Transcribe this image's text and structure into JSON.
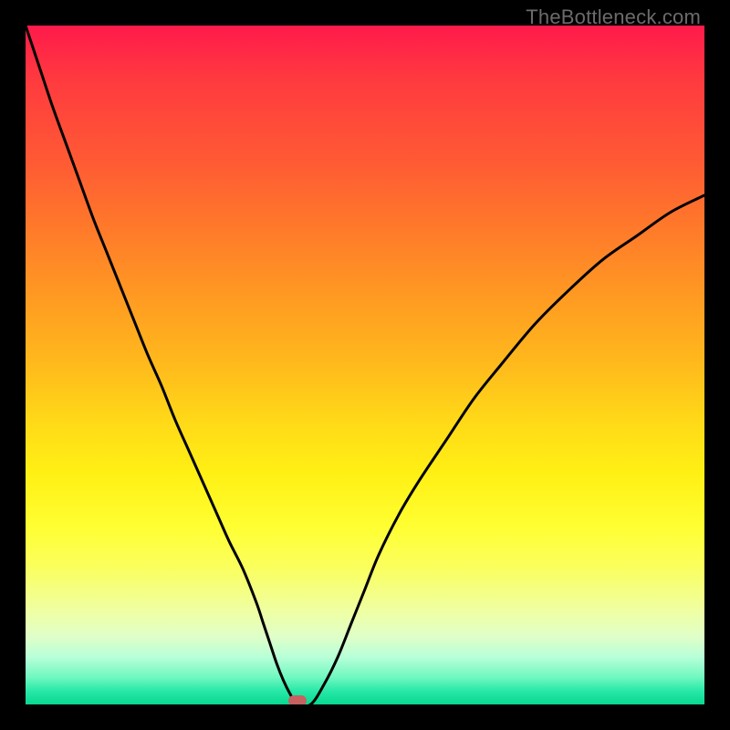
{
  "watermark": "TheBottleneck.com",
  "colors": {
    "frame": "#000000",
    "curve": "#000000",
    "marker": "#c76060"
  },
  "chart_data": {
    "type": "line",
    "title": "",
    "xlabel": "",
    "ylabel": "",
    "xlim": [
      0,
      100
    ],
    "ylim": [
      0,
      100
    ],
    "grid": false,
    "legend": false,
    "series": [
      {
        "name": "bottleneck-curve",
        "x": [
          0,
          2,
          4,
          6,
          8,
          10,
          12,
          14,
          16,
          18,
          20,
          22,
          24,
          26,
          28,
          30,
          32,
          34,
          35,
          36,
          37,
          38,
          39,
          40,
          42,
          44,
          46,
          48,
          50,
          52,
          55,
          58,
          62,
          66,
          70,
          75,
          80,
          85,
          90,
          95,
          100
        ],
        "y": [
          100,
          94,
          88,
          82.5,
          77,
          71.5,
          66.5,
          61.5,
          56.5,
          51.5,
          47,
          42,
          37.5,
          33,
          28.5,
          24,
          20,
          15,
          12,
          9,
          6,
          3.5,
          1.5,
          0,
          0,
          3,
          7,
          12,
          17,
          22,
          28,
          33,
          39,
          45,
          50,
          56,
          61,
          65.5,
          69,
          72.5,
          75
        ]
      }
    ],
    "marker": {
      "x": 40,
      "y": 0,
      "name": "optimal-point"
    },
    "background_gradient": {
      "orientation": "vertical",
      "stops": [
        {
          "pct": 0,
          "color": "#ff1a4b"
        },
        {
          "pct": 50,
          "color": "#ffd818"
        },
        {
          "pct": 74,
          "color": "#ffff33"
        },
        {
          "pct": 100,
          "color": "#08d890"
        }
      ]
    }
  }
}
